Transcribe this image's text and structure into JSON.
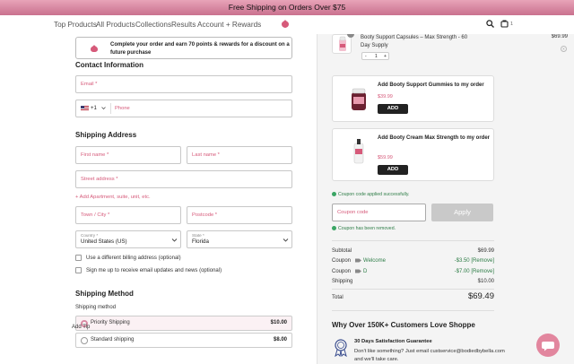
{
  "banner": {
    "text": "Free Shipping on Orders Over $75"
  },
  "nav": {
    "items": [
      "Top Products",
      "All Products",
      "Collections",
      "Results",
      "Account + Rewards"
    ],
    "cart_count": "1"
  },
  "promo": {
    "text": "Complete your order and earn 70 points & rewards for a discount on a future purchase"
  },
  "contact": {
    "heading": "Contact Information",
    "email_placeholder": "Email *",
    "country_code": "+1",
    "phone_placeholder": "Phone"
  },
  "shipping_address": {
    "heading": "Shipping Address",
    "first_name_placeholder": "First name *",
    "last_name_placeholder": "Last name *",
    "street_placeholder": "Street address *",
    "add_apartment": "+ Add Apartment, suite, unit, etc.",
    "town_placeholder": "Town / City *",
    "postcode_placeholder": "Postcode *",
    "country_label": "Country *",
    "country_value": "United States (US)",
    "state_label": "State *",
    "state_value": "Florida",
    "billing_checkbox": "Use a different billing address (optional)",
    "email_updates_checkbox": "Sign me up to receive email updates and news (optional)"
  },
  "shipping_method": {
    "heading": "Shipping Method",
    "sublabel": "Shipping method",
    "options": [
      {
        "name": "Priority Shipping",
        "price": "$10.00",
        "selected": true
      },
      {
        "name": "Standard shipping",
        "price": "$8.00",
        "selected": false
      }
    ],
    "add_tip": "Add Tip"
  },
  "cart": {
    "product_name": "Booty Support Capsules – Max Strength - 60 Day Supply",
    "product_price": "$69.99",
    "quantity": "1",
    "minus": "-",
    "plus": "+",
    "remove": "×"
  },
  "upsells": [
    {
      "name": "Add Booty Support Gummies to my order",
      "price": "$39.99",
      "button": "ADD"
    },
    {
      "name": "Add Booty Cream Max Strength to my order",
      "price": "$59.99",
      "button": "ADD"
    }
  ],
  "coupon": {
    "applied_message": "Coupon code applied successfully.",
    "placeholder": "Coupon code",
    "apply_label": "Apply",
    "removed_message": "Coupon has been removed."
  },
  "summary": {
    "subtotal_label": "Subtotal",
    "subtotal_value": "$69.99",
    "coupon_label": "Coupon",
    "coupon1_code": "Welcome",
    "coupon1_value": "-$3.50",
    "coupon2_code": "D",
    "coupon2_value": "-$7.00",
    "remove_label": "[Remove]",
    "shipping_label": "Shipping",
    "shipping_value": "$10.00",
    "total_label": "Total",
    "total_value": "$69.49"
  },
  "why": {
    "title": "Why Over 150K+ Customers Love Shoppe",
    "guarantee_title": "30 Days Satisfaction Guarantee",
    "guarantee_text": "Don't like something? Just email custservice@bodiedbybella.com and we'll take care."
  },
  "colors": {
    "accent": "#d65a7a",
    "banner": "#d98aa3",
    "chat": "#e2869e",
    "success": "#2e7d47"
  }
}
